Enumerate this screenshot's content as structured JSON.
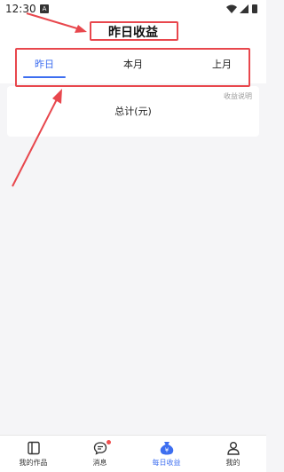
{
  "status_bar": {
    "time": "12:30",
    "notification_letter": "A",
    "icons": [
      "wifi-icon",
      "signal-icon",
      "battery-icon"
    ]
  },
  "header": {
    "title": "昨日收益"
  },
  "tabs": {
    "items": [
      {
        "label": "昨日",
        "active": true
      },
      {
        "label": "本月",
        "active": false
      },
      {
        "label": "上月",
        "active": false
      }
    ]
  },
  "card": {
    "help_link": "收益说明",
    "total_label": "总计(元)"
  },
  "bottom_nav": {
    "items": [
      {
        "label": "我的作品",
        "icon": "book-icon",
        "active": false
      },
      {
        "label": "消息",
        "icon": "chat-icon",
        "active": false,
        "badge": true
      },
      {
        "label": "每日收益",
        "icon": "money-bag-icon",
        "active": true
      },
      {
        "label": "我的",
        "icon": "person-icon",
        "active": false
      }
    ]
  },
  "colors": {
    "accent": "#3d6ef0",
    "annotation": "#e8474d",
    "background": "#f5f5f7"
  }
}
